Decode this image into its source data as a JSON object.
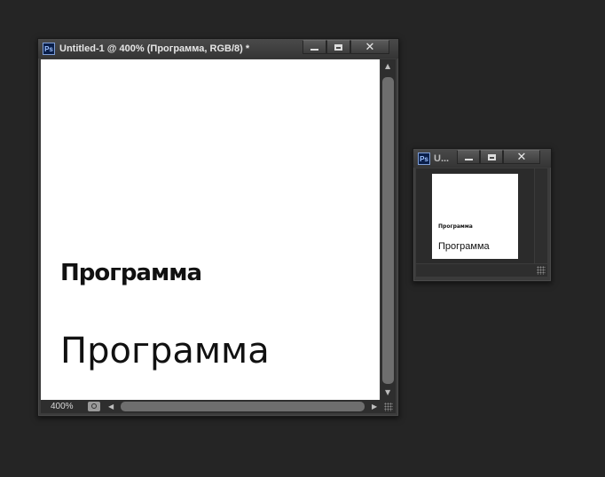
{
  "main_window": {
    "app_icon": "ps-icon",
    "app_icon_text": "Ps",
    "title": "Untitled-1 @ 400% (Программа, RGB/8) *",
    "canvas_text_small": "Программа",
    "canvas_text_large": "Программа",
    "zoom_level": "400%"
  },
  "navigator_window": {
    "app_icon_text": "Ps",
    "title": "U...",
    "preview_text_small": "Программа",
    "preview_text_large": "Программа"
  },
  "colors": {
    "background": "#252525",
    "window": "#3b3b3b",
    "canvas": "#ffffff"
  }
}
